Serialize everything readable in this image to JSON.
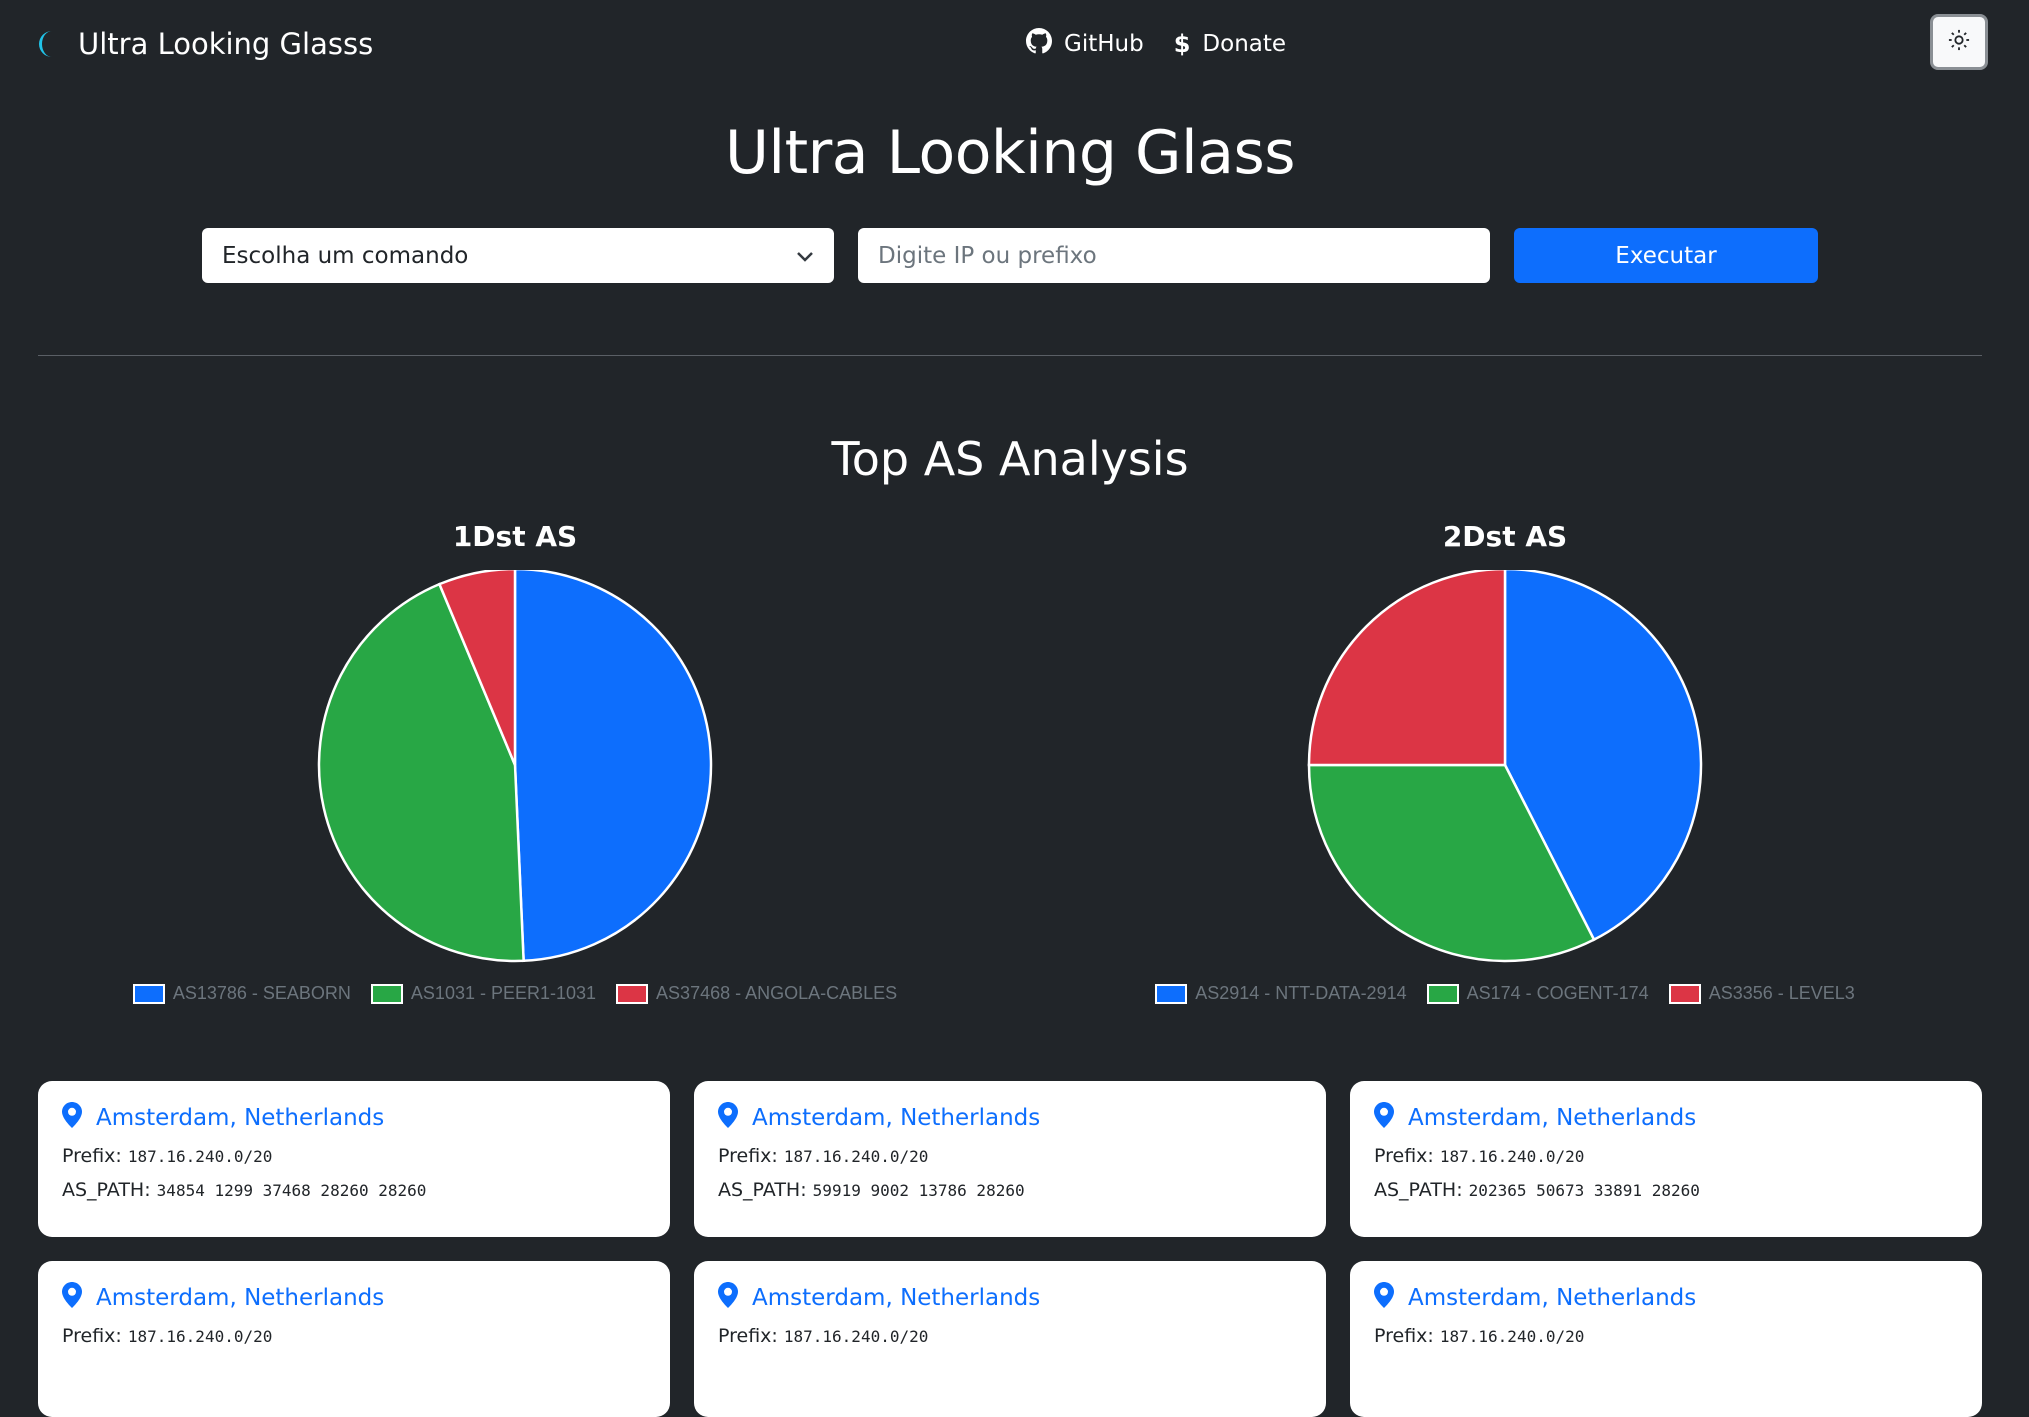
{
  "navbar": {
    "brand": "Ultra Looking Glasss",
    "links": [
      {
        "label": "GitHub",
        "icon": "github-icon"
      },
      {
        "label": "Donate",
        "icon": "dollar-icon"
      }
    ],
    "theme_toggle_icon": "sun-icon"
  },
  "main_title": "Ultra Looking Glass",
  "controls": {
    "select_value": "Escolha um comando",
    "input_placeholder": "Digite IP ou prefixo",
    "execute_label": "Executar"
  },
  "section_title": "Top AS Analysis",
  "chart_data": [
    {
      "type": "pie",
      "title": "1Dst AS",
      "categories": [
        "AS13786 - SEABORN",
        "AS1031 - PEER1-1031",
        "AS37468 - ANGOLA-CABLES"
      ],
      "values": [
        49.3,
        44.4,
        6.3
      ],
      "colors": [
        "#0d6efd",
        "#28a745",
        "#dc3545"
      ],
      "legend": "bottom"
    },
    {
      "type": "pie",
      "title": "2Dst AS",
      "categories": [
        "AS2914 - NTT-DATA-2914",
        "AS174 - COGENT-174",
        "AS3356 - LEVEL3"
      ],
      "values": [
        42.5,
        32.5,
        25
      ],
      "colors": [
        "#0d6efd",
        "#28a745",
        "#dc3545"
      ],
      "legend": "bottom"
    }
  ],
  "cards": [
    {
      "location": "Amsterdam, Netherlands",
      "prefix_label": "Prefix:",
      "prefix": "187.16.240.0/20",
      "path_label": "AS_PATH:",
      "as_path": "34854 1299 37468 28260 28260"
    },
    {
      "location": "Amsterdam, Netherlands",
      "prefix_label": "Prefix:",
      "prefix": "187.16.240.0/20",
      "path_label": "AS_PATH:",
      "as_path": "59919 9002 13786 28260"
    },
    {
      "location": "Amsterdam, Netherlands",
      "prefix_label": "Prefix:",
      "prefix": "187.16.240.0/20",
      "path_label": "AS_PATH:",
      "as_path": "202365 50673 33891 28260"
    },
    {
      "location": "Amsterdam, Netherlands",
      "prefix_label": "Prefix:",
      "prefix": "187.16.240.0/20",
      "path_label": "",
      "as_path": ""
    },
    {
      "location": "Amsterdam, Netherlands",
      "prefix_label": "Prefix:",
      "prefix": "187.16.240.0/20",
      "path_label": "",
      "as_path": ""
    },
    {
      "location": "Amsterdam, Netherlands",
      "prefix_label": "Prefix:",
      "prefix": "187.16.240.0/20",
      "path_label": "",
      "as_path": ""
    }
  ]
}
